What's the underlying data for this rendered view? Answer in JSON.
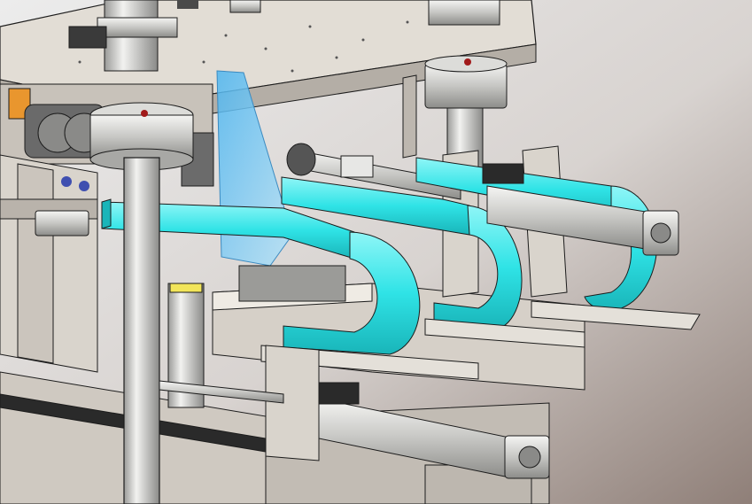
{
  "scene": {
    "subject": "cad-render-machine-assembly",
    "colors": {
      "background_light": "#ececec",
      "background_dark": "#8f7f78",
      "frame": "#d9d4cc",
      "frame_shadow": "#a9a39b",
      "steel": "#c9c9c6",
      "steel_dark": "#8a8a88",
      "cyan": "#2fe3e6",
      "cyan_dark": "#17b9bd",
      "glass": "#6fc8f4",
      "orange": "#e9962e",
      "yellow": "#f2e55a",
      "outline": "#1c1c1c"
    }
  }
}
